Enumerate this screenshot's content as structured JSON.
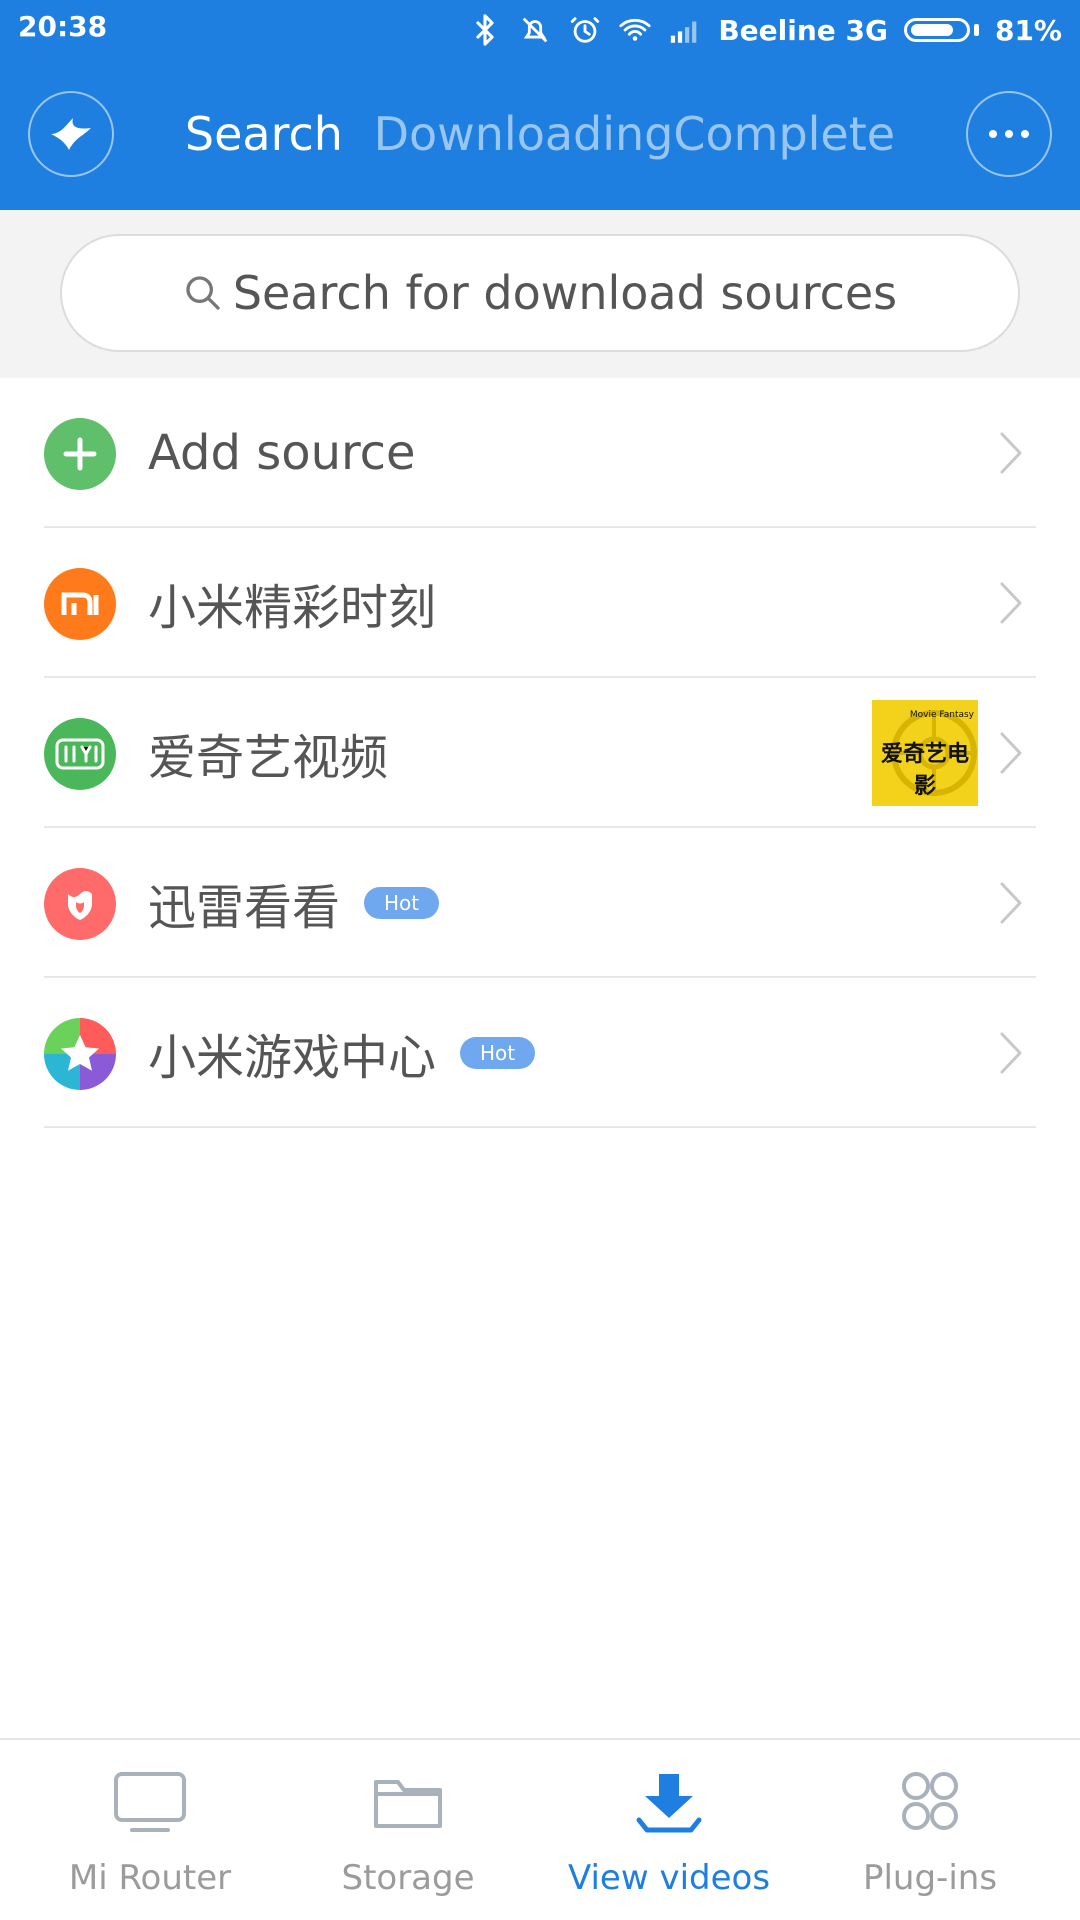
{
  "status_bar": {
    "time": "20:38",
    "carrier": "Beeline 3G",
    "battery_percent_text": "81%",
    "battery_level": 0.81,
    "icons": [
      "bluetooth-icon",
      "mute-icon",
      "alarm-icon",
      "wifi-icon",
      "signal-icon",
      "battery-icon"
    ]
  },
  "header": {
    "left_icon": "bird-logo-icon",
    "tabs": [
      {
        "label": "Search",
        "active": true
      },
      {
        "label": "Downloading",
        "active": false
      },
      {
        "label": "Complete",
        "active": false
      }
    ],
    "right_icon": "more-icon"
  },
  "search": {
    "placeholder": "Search for download sources",
    "icon": "search-icon"
  },
  "sources": [
    {
      "label": "Add source",
      "icon": "add-icon",
      "hot": false,
      "avatar_color": "#5fbf6a"
    },
    {
      "label": "小米精彩时刻",
      "icon": "mi-icon",
      "hot": false,
      "avatar_color": "#ff7a1a"
    },
    {
      "label": "爱奇艺视频",
      "icon": "iqiyi-icon",
      "hot": false,
      "avatar_color": "#4ab85a",
      "thumbnail": {
        "text": "爱奇艺电影",
        "subtext": "Movie Fantasy"
      }
    },
    {
      "label": "迅雷看看",
      "icon": "xunlei-icon",
      "hot": true,
      "hot_label": "Hot",
      "avatar_color": "#ff6b6b"
    },
    {
      "label": "小米游戏中心",
      "icon": "game-center-icon",
      "hot": true,
      "hot_label": "Hot",
      "avatar_color": "#8b5ad6"
    }
  ],
  "bottom_nav": {
    "items": [
      {
        "label": "Mi Router",
        "icon": "tv-icon",
        "active": false
      },
      {
        "label": "Storage",
        "icon": "folder-icon",
        "active": false
      },
      {
        "label": "View videos",
        "icon": "download-icon",
        "active": true
      },
      {
        "label": "Plug-ins",
        "icon": "plugins-icon",
        "active": false
      }
    ]
  },
  "colors": {
    "brand_blue": "#1e7fe0",
    "hot_badge": "#6fa8ef",
    "text": "#555555"
  }
}
